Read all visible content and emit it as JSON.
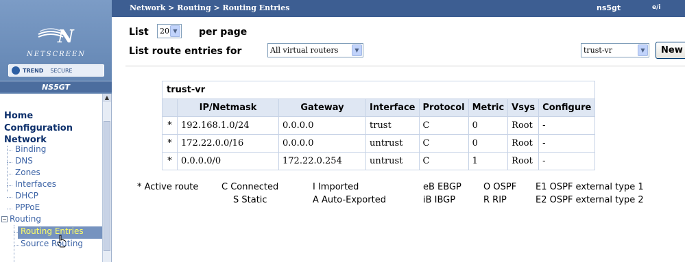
{
  "sidebar": {
    "brand": "NETSCREEN",
    "trend_label": "TREND",
    "secure_label": "SECURE",
    "model": "NS5GT",
    "nav": {
      "home": "Home",
      "configuration": "Configuration",
      "network": "Network",
      "binding": "Binding",
      "dns": "DNS",
      "zones": "Zones",
      "interfaces": "Interfaces",
      "dhcp": "DHCP",
      "pppoe": "PPPoE",
      "routing": "Routing",
      "routing_entries": "Routing Entries",
      "source_routing": "Source Routing"
    }
  },
  "header": {
    "breadcrumb": "Network > Routing > Routing Entries",
    "device": "ns5gt",
    "extra": "e/i"
  },
  "controls": {
    "list_label": "List",
    "per_page_value": "20",
    "per_page_label": "per page",
    "route_entries_label": "List route entries for",
    "virtual_router_filter": "All virtual routers",
    "vr_select": "trust-vr",
    "new_button": "New"
  },
  "table": {
    "caption": "trust-vr",
    "columns": [
      "IP/Netmask",
      "Gateway",
      "Interface",
      "Protocol",
      "Metric",
      "Vsys",
      "Configure"
    ],
    "rows": [
      {
        "active": "*",
        "ip": "192.168.1.0/24",
        "gateway": "0.0.0.0",
        "interface": "trust",
        "protocol": "C",
        "metric": "0",
        "vsys": "Root",
        "configure": "-"
      },
      {
        "active": "*",
        "ip": "172.22.0.0/16",
        "gateway": "0.0.0.0",
        "interface": "untrust",
        "protocol": "C",
        "metric": "0",
        "vsys": "Root",
        "configure": "-"
      },
      {
        "active": "*",
        "ip": "0.0.0.0/0",
        "gateway": "172.22.0.254",
        "interface": "untrust",
        "protocol": "C",
        "metric": "1",
        "vsys": "Root",
        "configure": "-"
      }
    ]
  },
  "legend": {
    "active_route": "* Active route",
    "c": "C Connected",
    "i": "I Imported",
    "eb": "eB EBGP",
    "o": "O OSPF",
    "e1": "E1 OSPF external type 1",
    "s": "S Static",
    "a": "A Auto-Exported",
    "ib": "iB IBGP",
    "r": "R RIP",
    "e2": "E2 OSPF external type 2"
  },
  "colors": {
    "header_bg": "#3d5e92",
    "sidebar_bg": "#6b8bb5",
    "table_header_bg": "#dfe7f3",
    "nav_selected_text": "#ffff66"
  }
}
